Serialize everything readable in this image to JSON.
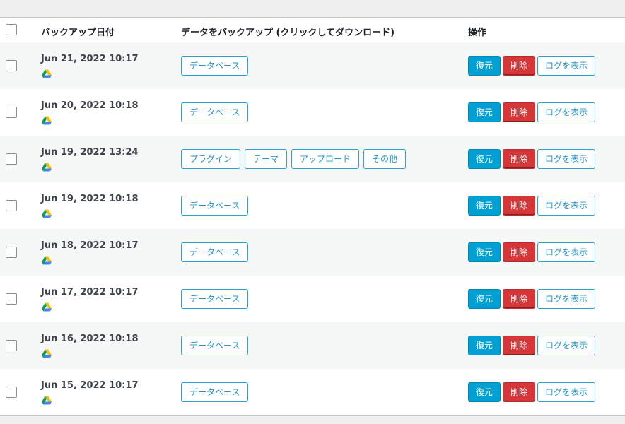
{
  "table": {
    "headers": {
      "date": "バックアップ日付",
      "download": "データをバックアップ (クリックしてダウンロード)",
      "actions": "操作"
    },
    "action_labels": {
      "restore": "復元",
      "delete": "削除",
      "log": "ログを表示"
    },
    "storage_icon": "google-drive-icon",
    "colors": {
      "restore": "#00a0d2",
      "delete": "#d63638",
      "link": "#2ea2cc"
    },
    "rows": [
      {
        "date": "Jun 21, 2022 10:17",
        "items": [
          "データベース"
        ]
      },
      {
        "date": "Jun 20, 2022 10:18",
        "items": [
          "データベース"
        ]
      },
      {
        "date": "Jun 19, 2022 13:24",
        "items": [
          "プラグイン",
          "テーマ",
          "アップロード",
          "その他"
        ]
      },
      {
        "date": "Jun 19, 2022 10:18",
        "items": [
          "データベース"
        ]
      },
      {
        "date": "Jun 18, 2022 10:17",
        "items": [
          "データベース"
        ]
      },
      {
        "date": "Jun 17, 2022 10:17",
        "items": [
          "データベース"
        ]
      },
      {
        "date": "Jun 16, 2022 10:18",
        "items": [
          "データベース"
        ]
      },
      {
        "date": "Jun 15, 2022 10:17",
        "items": [
          "データベース"
        ]
      }
    ]
  }
}
